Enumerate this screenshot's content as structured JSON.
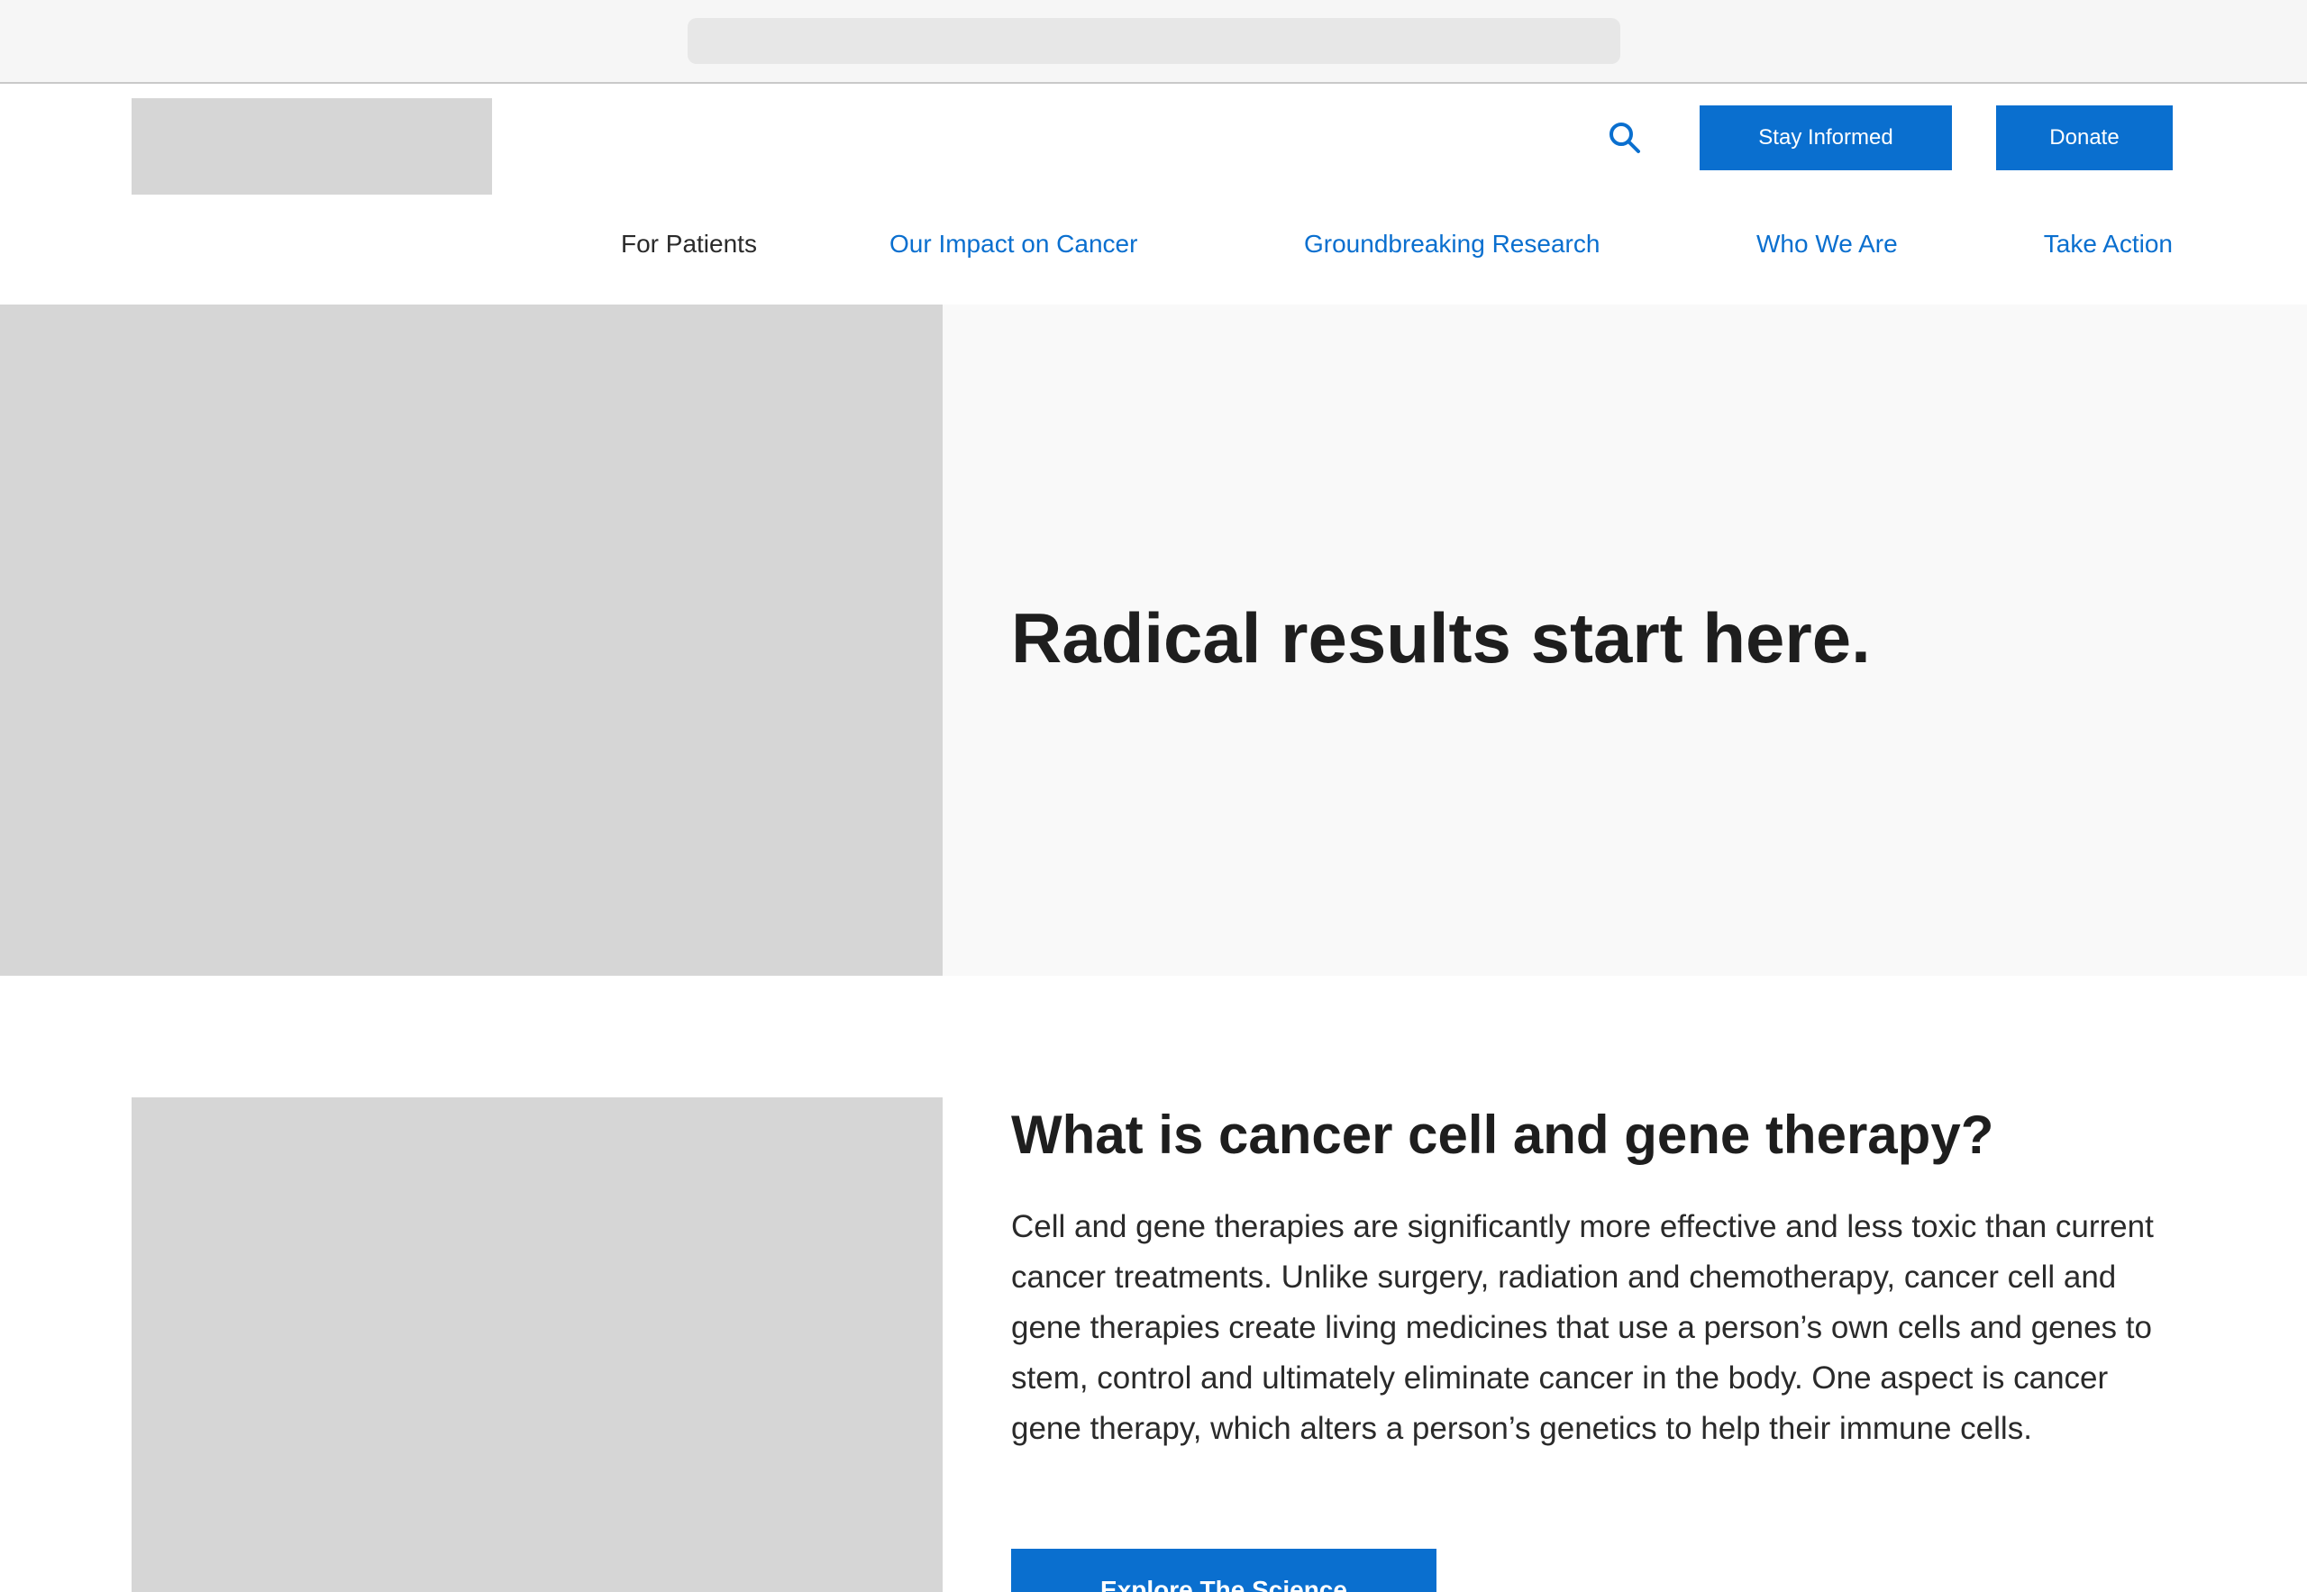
{
  "header": {
    "search_icon": "search-icon",
    "stay_informed_label": "Stay Informed",
    "donate_label": "Donate"
  },
  "nav": {
    "items": [
      {
        "label": "For Patients"
      },
      {
        "label": "Our Impact on Cancer"
      },
      {
        "label": "Groundbreaking Research"
      },
      {
        "label": "Who We Are"
      },
      {
        "label": "Take Action"
      }
    ]
  },
  "hero": {
    "title": "Radical results start here."
  },
  "section": {
    "title": "What is cancer cell and gene therapy?",
    "body": "Cell and gene therapies are significantly more effective and less toxic than current cancer treatments. Unlike surgery, radiation and chemotherapy, cancer cell and gene therapies create living medicines that use a person’s own cells and genes to stem, control and ultimately eliminate cancer in the body. One aspect is cancer gene therapy, which alters a person’s genetics to help their immune cells.",
    "cta_label": "Explore The Science"
  },
  "colors": {
    "accent": "#0a6fcf",
    "text": "#1e1e1e",
    "placeholder": "#d6d6d6",
    "hero_bg": "#f9f9f9"
  }
}
